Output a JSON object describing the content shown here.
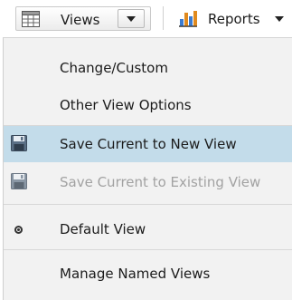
{
  "toolbar": {
    "views_label": "Views",
    "reports_label": "Reports",
    "views_icon": "table-grid-icon",
    "reports_icon": "bar-chart-icon"
  },
  "menu": {
    "items": [
      {
        "label": "Change/Custom",
        "state": "normal"
      },
      {
        "label": "Other View Options",
        "state": "normal"
      },
      {
        "label": "Save Current to New View",
        "state": "highlighted",
        "icon": "floppy-disk-icon"
      },
      {
        "label": "Save Current to Existing View",
        "state": "disabled",
        "icon": "floppy-disk-icon"
      },
      {
        "label": "Default View",
        "state": "selected",
        "icon": "radio-bullet-icon"
      },
      {
        "label": "Manage Named Views",
        "state": "normal"
      }
    ]
  },
  "colors": {
    "menu_background": "#f2f2f2",
    "highlight": "#c3dcea",
    "disabled_text": "#a2a2a2",
    "toolbar_border": "#c9c9c9"
  }
}
